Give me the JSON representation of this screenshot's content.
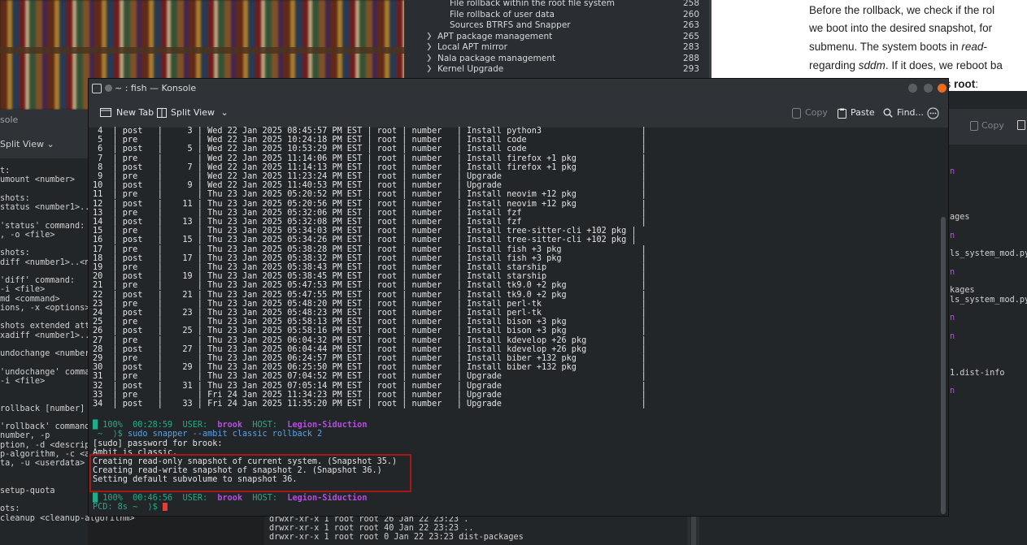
{
  "toc": {
    "items": [
      {
        "label": "File rollback within the root file system",
        "page": "258",
        "indent": 2
      },
      {
        "label": "File rollback of user data",
        "page": "260",
        "indent": 2
      },
      {
        "label": "Sources BTRFS and Snapper",
        "page": "263",
        "indent": 2
      },
      {
        "label": "APT package management",
        "page": "265",
        "indent": 1
      },
      {
        "label": "Local APT mirror",
        "page": "283",
        "indent": 1
      },
      {
        "label": "Nala package management",
        "page": "288",
        "indent": 1
      },
      {
        "label": "Kernel Upgrade",
        "page": "293",
        "indent": 1
      }
    ]
  },
  "document": {
    "lines": [
      "Before the rollback, we check if the rol",
      "we boot into the desired snapshot, for",
      "submenu. The system boots in read-",
      "regarding sddm. If it does, we reboot ba",
      "as root:"
    ]
  },
  "left_konsole": {
    "title": "sole",
    "toolbar_label": "Split View",
    "lines": [
      "t:",
      "umount <number>",
      "",
      "shots:",
      "status <number1>..",
      "",
      "'status' command:",
      ", -o <file>",
      "",
      "shots:",
      "diff <number1>..<n",
      "",
      "'diff' command:",
      " -i <file>",
      "md <command>",
      "ions, -x <options>",
      "",
      "shots extended att",
      "xadiff <number1>..",
      "",
      "undochange <number",
      "",
      "'undochange' comma",
      " -i <file>",
      "",
      "",
      "rollback [number]",
      "",
      "'rollback' command",
      "number, -p",
      "ption, -d <descrip",
      "p-algorithm, -c <a",
      "ta, -u <userdata>",
      "",
      "",
      "setup-quota",
      "",
      "ots:",
      "cleanup <cleanup-algorithm>"
    ]
  },
  "right_konsole": {
    "copy_label": "Copy",
    "lines": [
      {
        "text": "n",
        "color": "#b64ce0",
        "row": 0
      },
      {
        "text": "ages",
        "color": "#d0d0d0",
        "row": 5
      },
      {
        "text": "n",
        "color": "#b64ce0",
        "row": 7
      },
      {
        "text": "ls_system_mod.py",
        "color": "#d0d0d0",
        "row": 9
      },
      {
        "text": "n",
        "color": "#b64ce0",
        "row": 11
      },
      {
        "text": "kages",
        "color": "#d0d0d0",
        "row": 13
      },
      {
        "text": "ls_system_mod.py",
        "color": "#d0d0d0",
        "row": 14
      },
      {
        "text": "n",
        "color": "#b64ce0",
        "row": 16
      },
      {
        "text": "n",
        "color": "#b64ce0",
        "row": 18
      },
      {
        "text": "1.dist-info",
        "color": "#d0d0d0",
        "row": 22
      },
      {
        "text": "n",
        "color": "#b64ce0",
        "row": 24
      }
    ]
  },
  "bottom_konsole": {
    "lines": [
      "drwxr-xr-x 1 root root 26 Jan 22 23:23 .",
      "drwxr-xr-x 1 root root 40 Jan 22 23:23 ..",
      "drwxr-xr-x 1 root root  0 Jan 22 23:23 dist-packages"
    ]
  },
  "window": {
    "title": "~ : fish — Konsole",
    "toolbar": {
      "new_tab": "New Tab",
      "split_view": "Split View",
      "copy": "Copy",
      "paste": "Paste",
      "find": "Find..."
    }
  },
  "terminal": {
    "snapshot_rows": [
      " 4  | post   |     3 | Wed 22 Jan 2025 08:45:57 PM EST | root | number   | Install python3                    |",
      " 5  | pre    |       | Wed 22 Jan 2025 10:24:18 PM EST | root | number   | Install code                       |",
      " 6  | post   |     5 | Wed 22 Jan 2025 10:53:29 PM EST | root | number   | Install code                       |",
      " 7  | pre    |       | Wed 22 Jan 2025 11:14:06 PM EST | root | number   | Install firefox +1 pkg             |",
      " 8  | post   |     7 | Wed 22 Jan 2025 11:14:13 PM EST | root | number   | Install firefox +1 pkg             |",
      " 9  | pre    |       | Wed 22 Jan 2025 11:23:24 PM EST | root | number   | Upgrade                            |",
      "10  | post   |     9 | Wed 22 Jan 2025 11:40:53 PM EST | root | number   | Upgrade                            |",
      "11  | pre    |       | Thu 23 Jan 2025 05:20:52 PM EST | root | number   | Install neovim +12 pkg             |",
      "12  | post   |    11 | Thu 23 Jan 2025 05:20:56 PM EST | root | number   | Install neovim +12 pkg             |",
      "13  | pre    |       | Thu 23 Jan 2025 05:32:06 PM EST | root | number   | Install fzf                        |",
      "14  | post   |    13 | Thu 23 Jan 2025 05:32:08 PM EST | root | number   | Install fzf                        |",
      "15  | pre    |       | Thu 23 Jan 2025 05:34:03 PM EST | root | number   | Install tree-sitter-cli +102 pkg |",
      "16  | post   |    15 | Thu 23 Jan 2025 05:34:26 PM EST | root | number   | Install tree-sitter-cli +102 pkg |",
      "17  | pre    |       | Thu 23 Jan 2025 05:38:28 PM EST | root | number   | Install fish +3 pkg                |",
      "18  | post   |    17 | Thu 23 Jan 2025 05:38:32 PM EST | root | number   | Install fish +3 pkg                |",
      "19  | pre    |       | Thu 23 Jan 2025 05:38:43 PM EST | root | number   | Install starship                   |",
      "20  | post   |    19 | Thu 23 Jan 2025 05:38:45 PM EST | root | number   | Install starship                   |",
      "21  | pre    |       | Thu 23 Jan 2025 05:47:53 PM EST | root | number   | Install tk9.0 +2 pkg               |",
      "22  | post   |    21 | Thu 23 Jan 2025 05:47:55 PM EST | root | number   | Install tk9.0 +2 pkg               |",
      "23  | pre    |       | Thu 23 Jan 2025 05:48:20 PM EST | root | number   | Install perl-tk                    |",
      "24  | post   |    23 | Thu 23 Jan 2025 05:48:23 PM EST | root | number   | Install perl-tk                    |",
      "25  | pre    |       | Thu 23 Jan 2025 05:58:13 PM EST | root | number   | Install bison +3 pkg               |",
      "26  | post   |    25 | Thu 23 Jan 2025 05:58:16 PM EST | root | number   | Install bison +3 pkg               |",
      "27  | pre    |       | Thu 23 Jan 2025 06:04:32 PM EST | root | number   | Install kdevelop +26 pkg           |",
      "28  | post   |    27 | Thu 23 Jan 2025 06:04:44 PM EST | root | number   | Install kdevelop +26 pkg           |",
      "29  | pre    |       | Thu 23 Jan 2025 06:24:57 PM EST | root | number   | Install biber +132 pkg             |",
      "30  | post   |    29 | Thu 23 Jan 2025 06:25:50 PM EST | root | number   | Install biber +132 pkg             |",
      "31  | pre    |       | Thu 23 Jan 2025 07:04:52 PM EST | root | number   | Upgrade                            |",
      "32  | post   |    31 | Thu 23 Jan 2025 07:05:14 PM EST | root | number   | Upgrade                            |",
      "33  | pre    |       | Fri 24 Jan 2025 11:34:23 PM EST | root | number   | Upgrade                            |",
      "34  | post   |    33 | Fri 24 Jan 2025 11:35:20 PM EST | root | number   | Upgrade                            |"
    ],
    "prompt1": {
      "battery": "█ 100%",
      "time": "00:28:59",
      "user_label": "USER:",
      "user": "brook",
      "host_label": "HOST:",
      "host": "Legion-Siduction"
    },
    "command": {
      "prefix": " ~  ⟩$ ",
      "text": "sudo snapper --ambit classic rollback 2"
    },
    "output": [
      "[sudo] password for brook:",
      "Ambit is classic.",
      "Creating read-only snapshot of current system. (Snapshot 35.)",
      "Creating read-write snapshot of snapshot 2. (Snapshot 36.)",
      "Setting default subvolume to snapshot 36."
    ],
    "prompt2": {
      "battery": "█ 100%",
      "time": "00:46:56",
      "user_label": "USER:",
      "user": "brook",
      "host_label": "HOST:",
      "host": "Legion-Siduction"
    },
    "pcd_line": "PCD: 8s ~  ⟩$ "
  },
  "colors": {
    "accent_green": "#1dae8b",
    "accent_purple": "#b64ce0",
    "highlight_red": "#a61818",
    "close_orange": "#f06a1c"
  }
}
